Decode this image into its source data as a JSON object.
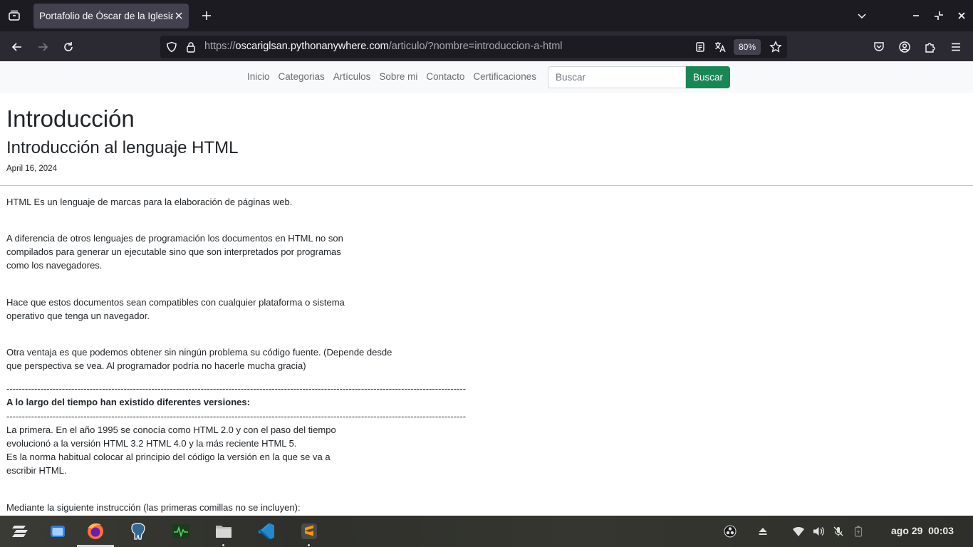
{
  "browser": {
    "tab_title": "Portafolio de Óscar de la Iglesias",
    "url_prefix": "https://",
    "url_host": "oscariglsan.pythonanywhere.com",
    "url_path": "/articulo/?nombre=introduccion-a-html",
    "zoom": "80%"
  },
  "site_nav": {
    "items": [
      "Inicio",
      "Categorias",
      "Artículos",
      "Sobre mi",
      "Contacto",
      "Certificaciones"
    ],
    "search_placeholder": "Buscar",
    "search_button": "Buscar"
  },
  "article": {
    "title": "Introducción",
    "subtitle": "Introducción al lenguaje HTML",
    "date": "April 16, 2024",
    "p1": "HTML Es un lenguaje de marcas para la elaboración de páginas web.",
    "p2": "A diferencia de otros lenguajes de programación los documentos en HTML no son\ncompilados para generar un ejecutable sino que son interpretados por programas\ncomo los navegadores.",
    "p3": "Hace que estos documentos sean compatibles con cualquier plataforma o sistema\noperativo que tenga un navegador.",
    "p4": "Otra ventaja es que podemos obtener sin ningún problema su código fuente. (Depende desde\nque perspectiva se vea. Al programador podría no hacerle mucha gracia)",
    "divider": "-----------------------------------------------------------------------------------------------------------------------------------------------------",
    "versions_heading": "A lo largo del tiempo han existido diferentes versiones:",
    "p5": "La primera. En el año 1995 se conocía como HTML 2.0 y con el paso del tiempo\nevolucionó a la versión HTML 3.2 HTML 4.0 y la más reciente HTML 5.\nEs la norma habitual colocar al principio del código la versión en la que se va a\nescribir HTML.",
    "p6": "Mediante la siguiente instrucción (las primeras comillas no se incluyen):"
  },
  "taskbar": {
    "clock": "ago 29  00:03"
  },
  "colors": {
    "accent_green": "#198754",
    "tab_bg": "#42414d",
    "toolbar_bg": "#2b2a33"
  }
}
